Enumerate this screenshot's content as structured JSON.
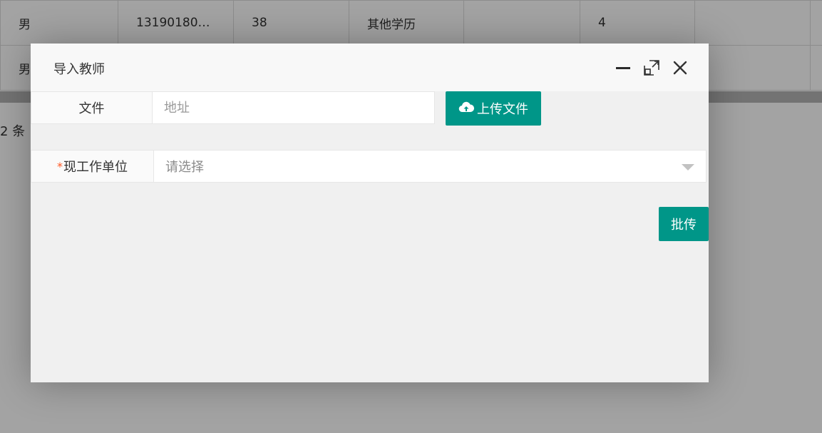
{
  "background": {
    "rows": [
      [
        "男",
        "13190180…",
        "38",
        "其他学历",
        "",
        "4",
        "",
        ""
      ],
      [
        "男",
        "",
        "",
        "",
        "",
        "",
        "",
        ""
      ]
    ],
    "total_text": "2 条"
  },
  "dialog": {
    "title": "导入教师",
    "minimize_icon": "minimize-icon",
    "maximize_icon": "maximize-icon",
    "close_icon": "close-icon",
    "file": {
      "label": "文件",
      "placeholder": "地址",
      "value": ""
    },
    "upload_button": {
      "icon": "cloud-upload-icon",
      "label": "上传文件"
    },
    "unit": {
      "required_mark": "*",
      "label": "现工作单位",
      "selected": "请选择"
    },
    "submit_button": "批传"
  },
  "colors": {
    "accent": "#009688",
    "required": "#ff5722",
    "overlay": "rgba(0,0,0,0.36)"
  }
}
